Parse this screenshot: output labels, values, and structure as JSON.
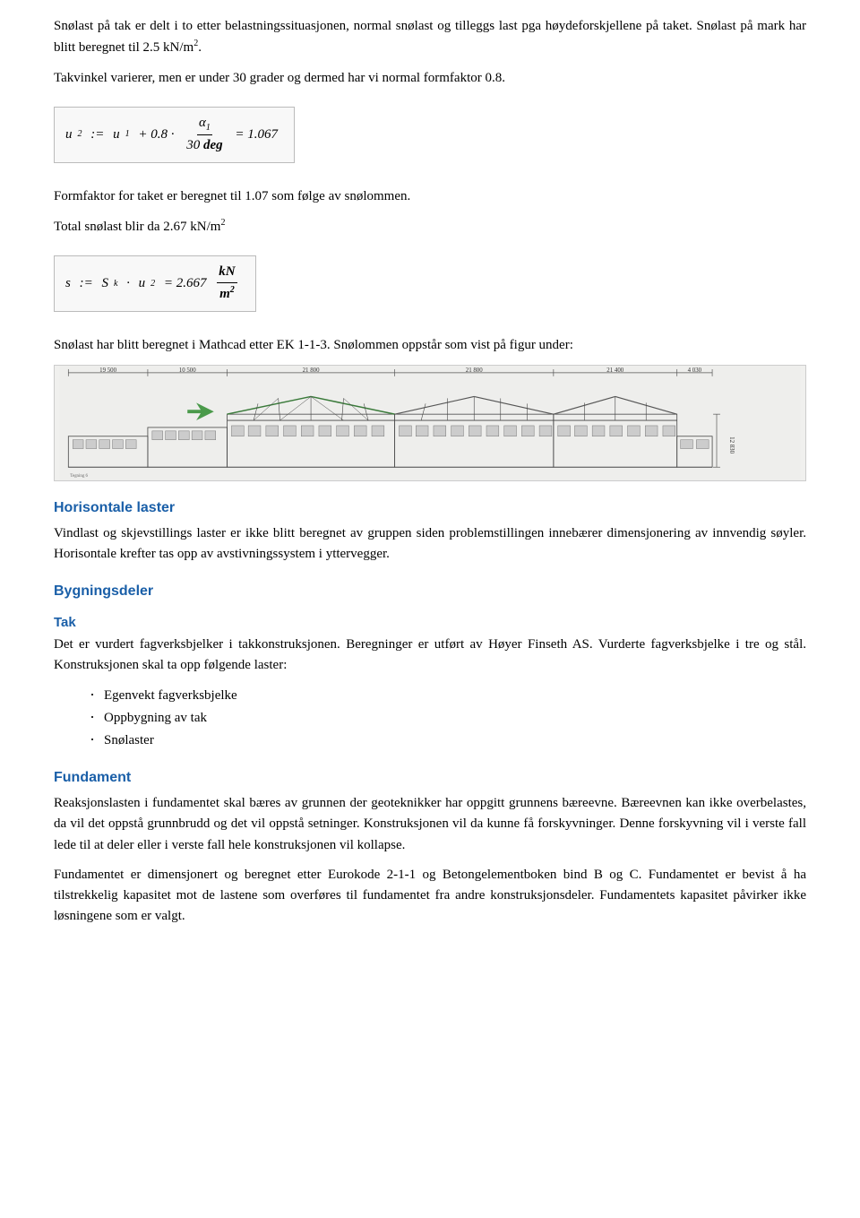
{
  "content": {
    "p1": "Snølast på tak er delt i to etter belastningssituasjonen, normal snølast og tilleggs last pga høydeforskjellene på taket. Snølast på mark har blitt beregnet til 2.5 kN/m².",
    "p2": "Takvinkel varierer, men er under 30 grader og dermed har vi normal formfaktor 0.8.",
    "formula1_label": "u₂ := u₁ + 0.8 · α₁ / 30 deg = 1.067",
    "p3": "Formfaktor for taket er beregnet til 1.07 som følge av snølommen.",
    "p4": "Total snølast blir da 2.67 kN/m²",
    "formula2_label": "s := Sₖ · u₂ = 2.667  kN/m²",
    "p5": "Snølast har blitt beregnet i Mathcad etter EK 1-1-3. Snølommen oppstår som vist på figur under:",
    "horisontale_heading": "Horisontale laster",
    "p6": "Vindlast og skjevstillings laster er ikke blitt beregnet av gruppen siden problemstillingen innebærer dimensjonering av innvendig søyler. Horisontale krefter tas opp av avstivningssystem i yttervegger.",
    "bygningsdeler_heading": "Bygningsdeler",
    "tak_heading": "Tak",
    "p7": "Det er vurdert fagverksbjelker i takkonstruksjonen. Beregninger er utført av Høyer Finseth AS. Vurderte fagverksbjelke i tre og stål. Konstruksjonen skal ta opp følgende laster:",
    "bullet1": "Egenvekt fagverksbjelke",
    "bullet2": "Oppbygning av tak",
    "bullet3": "Snølaster",
    "fundament_heading": "Fundament",
    "p8": "Reaksjonslasten i fundamentet skal bæres av grunnen der geoteknikker har oppgitt grunnens bæreevne. Bæreevnen kan ikke overbelastes, da vil det oppstå grunnbrudd og det vil oppstå setninger. Konstruksjonen vil da kunne få forskyvninger. Denne forskyvning vil i verste fall lede til at deler eller i verste fall hele konstruksjonen vil kollapse.",
    "p9": "Fundamentet er dimensjonert og beregnet etter Eurokode 2-1-1 og Betongelementboken bind B og C. Fundamentet er bevist å ha tilstrekkelig kapasitet mot de lastene som overføres til fundamentet fra andre konstruksjonsdeler. Fundamentets kapasitet påvirker ikke løsningene som er valgt."
  }
}
